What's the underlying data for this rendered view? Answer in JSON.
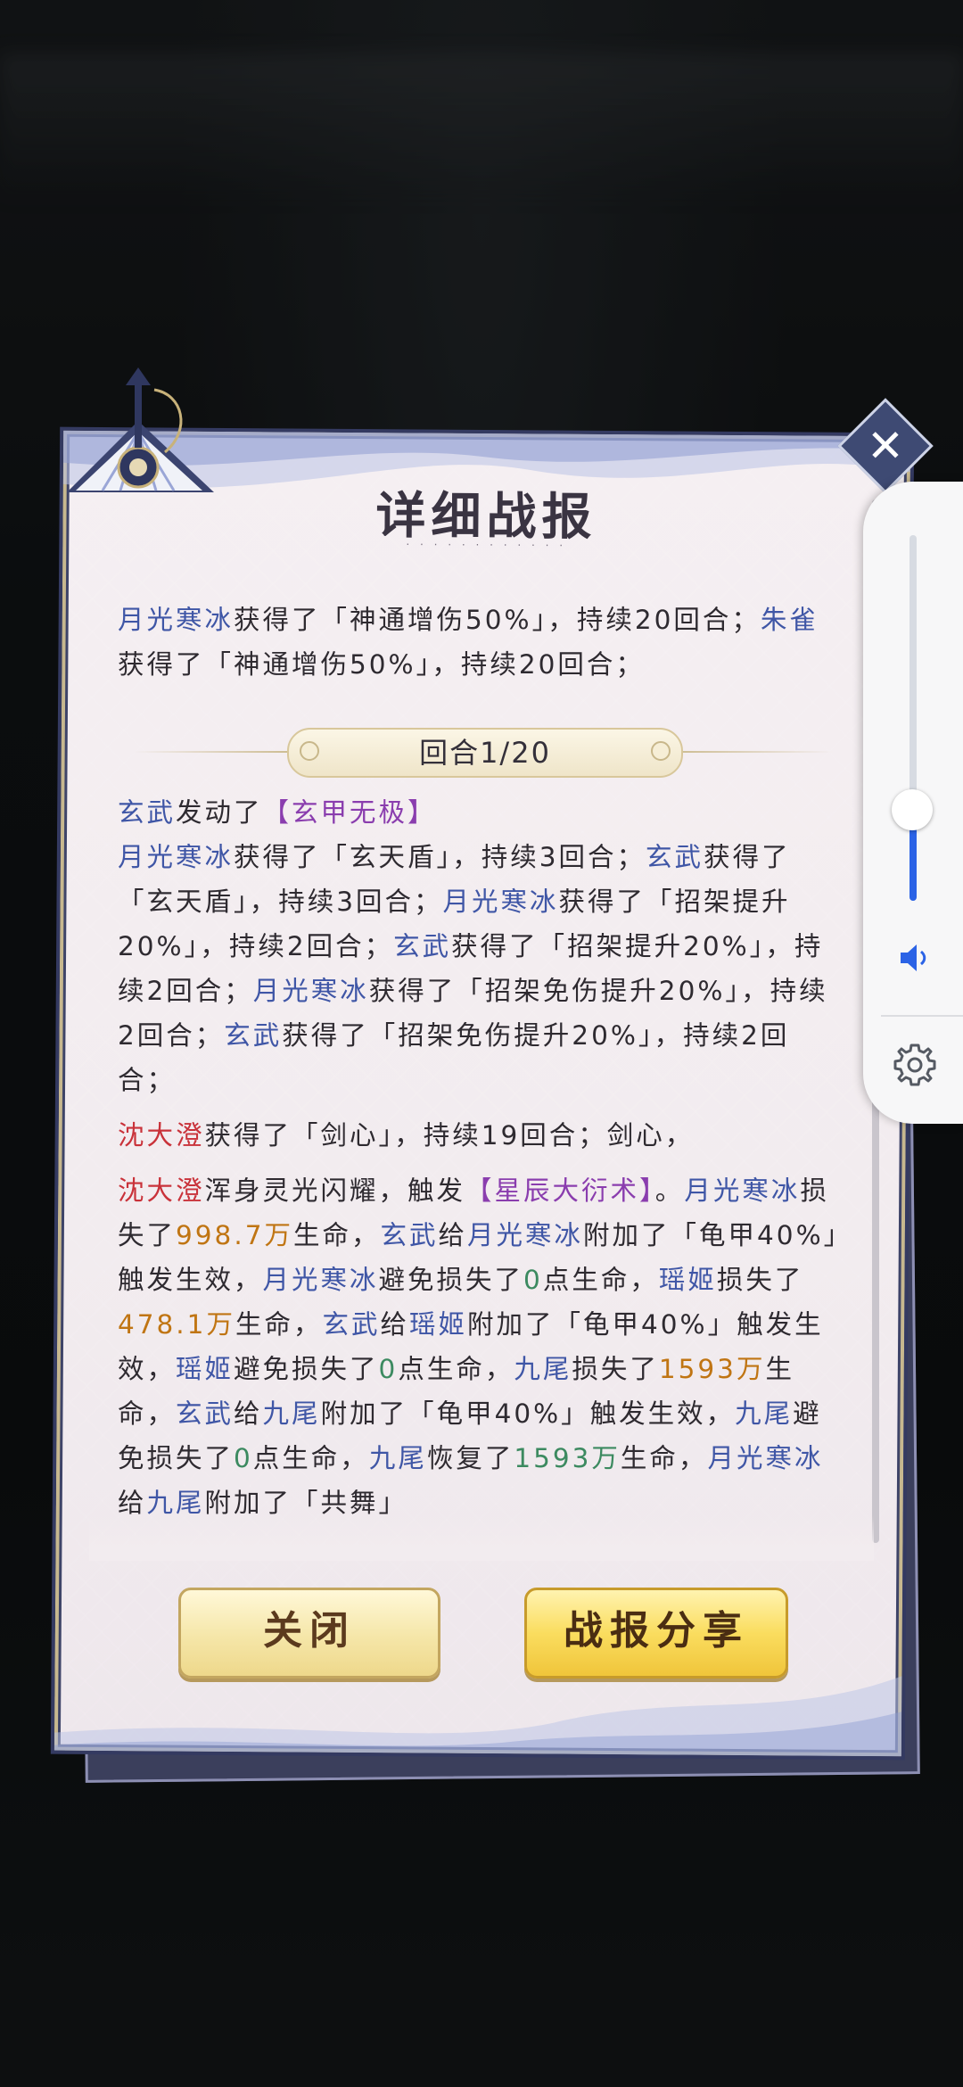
{
  "dialog": {
    "title": "详细战报",
    "title_sub": "· · · · · · · · · · · ·",
    "round_label": "回合1/20",
    "close_glyph": "✕"
  },
  "log": {
    "intro": [
      {
        "t": "月光寒冰",
        "c": "blue"
      },
      {
        "t": "获得了「神通增伤50%」，持续20回合；"
      },
      {
        "t": "朱雀",
        "c": "blue"
      },
      {
        "t": "获得了「神通增伤50%」，持续20回合；"
      }
    ],
    "round1": [
      [
        {
          "t": "玄武",
          "c": "blue"
        },
        {
          "t": "发动了"
        },
        {
          "t": "【玄甲无极】",
          "c": "purple"
        }
      ],
      [
        {
          "t": "月光寒冰",
          "c": "blue"
        },
        {
          "t": "获得了「玄天盾」，持续3回合；"
        },
        {
          "t": "玄武",
          "c": "blue"
        },
        {
          "t": "获得了「玄天盾」，持续3回合；"
        },
        {
          "t": "月光寒冰",
          "c": "blue"
        },
        {
          "t": "获得了「招架提升20%」，持续2回合；"
        },
        {
          "t": "玄武",
          "c": "blue"
        },
        {
          "t": "获得了「招架提升20%」，持续2回合；"
        },
        {
          "t": "月光寒冰",
          "c": "blue"
        },
        {
          "t": "获得了「招架免伤提升20%」，持续2回合；"
        },
        {
          "t": "玄武",
          "c": "blue"
        },
        {
          "t": "获得了「招架免伤提升20%」，持续2回合；"
        }
      ],
      [
        {
          "t": "沈大澄",
          "c": "red"
        },
        {
          "t": "获得了「剑心」，持续19回合；剑心，"
        }
      ],
      [
        {
          "t": "沈大澄",
          "c": "red"
        },
        {
          "t": "浑身灵光闪耀，触发"
        },
        {
          "t": "【星辰大衍术】",
          "c": "purple"
        },
        {
          "t": "。"
        },
        {
          "t": "月光寒冰",
          "c": "blue"
        },
        {
          "t": "损失了"
        },
        {
          "t": "998.7万",
          "c": "orange"
        },
        {
          "t": "生命，"
        },
        {
          "t": "玄武",
          "c": "blue"
        },
        {
          "t": "给"
        },
        {
          "t": "月光寒冰",
          "c": "blue"
        },
        {
          "t": "附加了「龟甲40%」触发生效，"
        },
        {
          "t": "月光寒冰",
          "c": "blue"
        },
        {
          "t": "避免损失了"
        },
        {
          "t": "0",
          "c": "green"
        },
        {
          "t": "点生命，"
        },
        {
          "t": "瑶姬",
          "c": "blue"
        },
        {
          "t": "损失了"
        },
        {
          "t": "478.1万",
          "c": "orange"
        },
        {
          "t": "生命，"
        },
        {
          "t": "玄武",
          "c": "blue"
        },
        {
          "t": "给"
        },
        {
          "t": "瑶姬",
          "c": "blue"
        },
        {
          "t": "附加了「龟甲40%」触发生效，"
        },
        {
          "t": "瑶姬",
          "c": "blue"
        },
        {
          "t": "避免损失了"
        },
        {
          "t": "0",
          "c": "green"
        },
        {
          "t": "点生命，"
        },
        {
          "t": "九尾",
          "c": "blue"
        },
        {
          "t": "损失了"
        },
        {
          "t": "1593万",
          "c": "orange"
        },
        {
          "t": "生命，"
        },
        {
          "t": "玄武",
          "c": "blue"
        },
        {
          "t": "给"
        },
        {
          "t": "九尾",
          "c": "blue"
        },
        {
          "t": "附加了「龟甲40%」触发生效，"
        },
        {
          "t": "九尾",
          "c": "blue"
        },
        {
          "t": "避免损失了"
        },
        {
          "t": "0",
          "c": "green"
        },
        {
          "t": "点生命，"
        },
        {
          "t": "九尾",
          "c": "blue"
        },
        {
          "t": "恢复了"
        },
        {
          "t": "1593万",
          "c": "green"
        },
        {
          "t": "生命，"
        },
        {
          "t": "月光寒冰",
          "c": "blue"
        },
        {
          "t": "给"
        },
        {
          "t": "九尾",
          "c": "blue"
        },
        {
          "t": "附加了「共舞」"
        }
      ]
    ]
  },
  "buttons": {
    "close_label": "关闭",
    "share_label": "战报分享"
  },
  "volume": {
    "level": 0.25,
    "speaker_icon": "speaker-icon",
    "settings_icon": "gear-icon",
    "accent": "#2b63e6"
  }
}
